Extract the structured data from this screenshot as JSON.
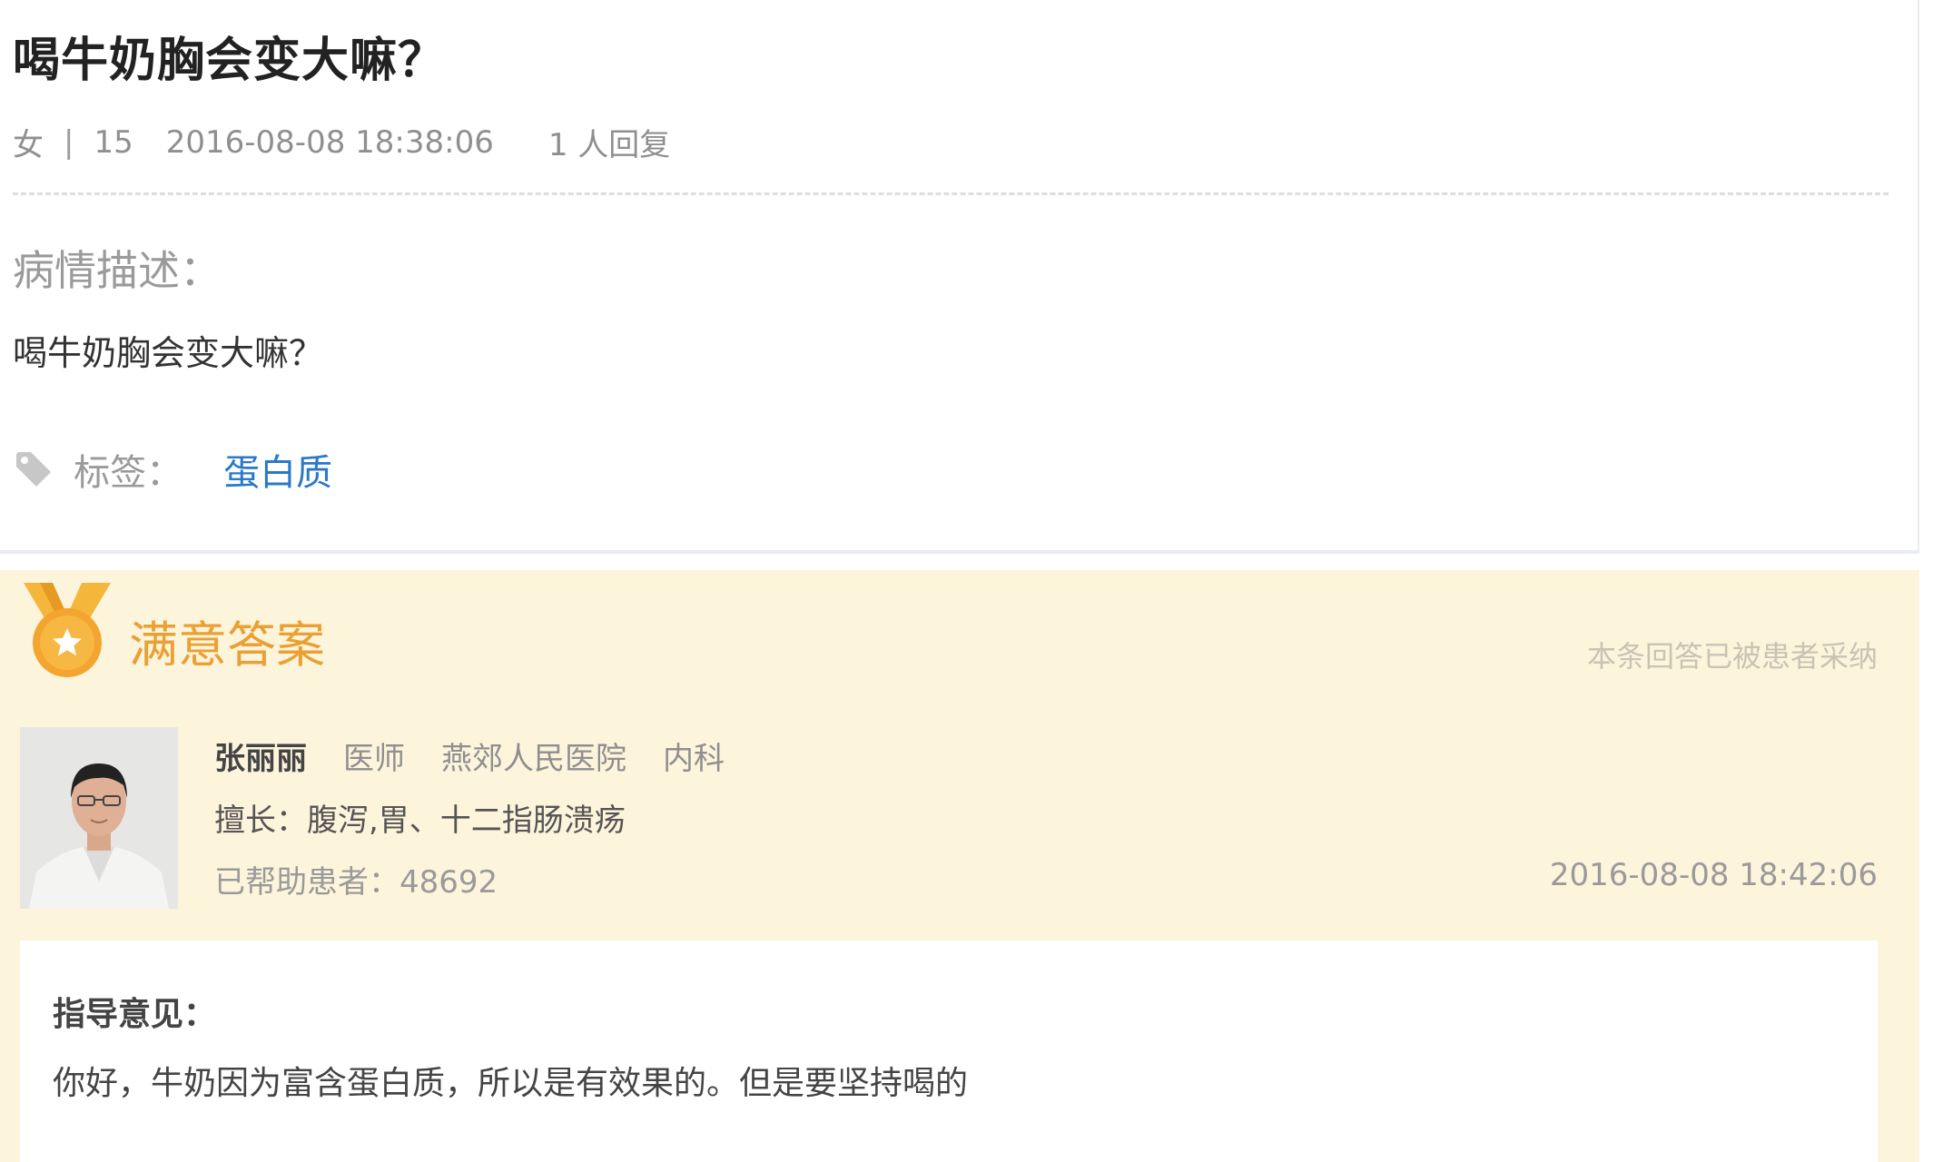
{
  "question": {
    "title": "喝牛奶胸会变大嘛？",
    "meta": {
      "gender": "女",
      "separator": "|",
      "age": "15",
      "datetime": "2016-08-08 18:38:06",
      "replies": "1 人回复"
    },
    "description_label": "病情描述：",
    "description_text": "喝牛奶胸会变大嘛？",
    "tags_label": "标签：",
    "tags": [
      "蛋白质"
    ],
    "tag_icon": "tag-icon"
  },
  "answer": {
    "badge_icon": "medal-star-icon",
    "title": "满意答案",
    "adopted_note": "本条回答已被患者采纳",
    "doctor": {
      "name": "张丽丽",
      "title": "医师",
      "hospital": "燕郊人民医院",
      "department": "内科",
      "specialty_label": "擅长：",
      "specialty": "腹泻,胃、十二指肠溃疡",
      "helped_label": "已帮助患者：",
      "helped_count": "48692"
    },
    "datetime": "2016-08-08 18:42:06",
    "guidance_label": "指导意见：",
    "guidance_text": "你好，牛奶因为富含蛋白质，所以是有效果的。但是要坚持喝的"
  },
  "colors": {
    "accent_orange": "#eaa033",
    "answer_background": "#fdf4dc",
    "tag_link": "#2a78c8"
  }
}
